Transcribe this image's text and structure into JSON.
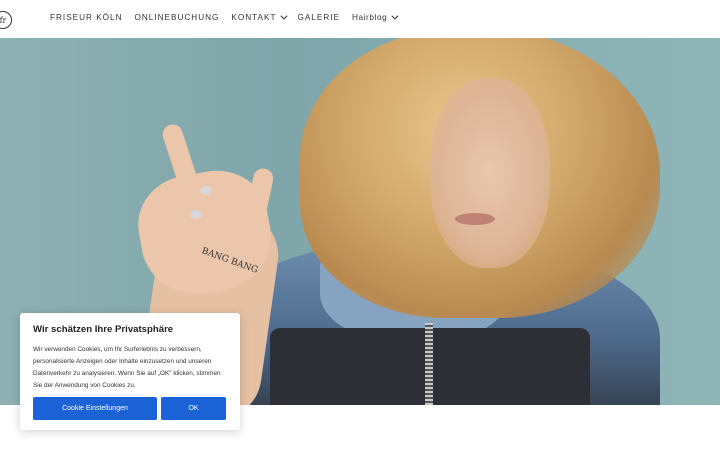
{
  "header": {
    "logo_text": "fr",
    "nav": [
      {
        "label": "FRISEUR KÖLN",
        "has_dropdown": false
      },
      {
        "label": "ONLINEBUCHUNG",
        "has_dropdown": false
      },
      {
        "label": "KONTAKT",
        "has_dropdown": true
      },
      {
        "label": "GALERIE",
        "has_dropdown": false
      },
      {
        "label": "Hairblog",
        "has_dropdown": true
      }
    ]
  },
  "hero": {
    "tattoo_text": "BANG BANG"
  },
  "cookie": {
    "title": "Wir schätzen Ihre Privatsphäre",
    "text": "Wir verwenden Cookies, um Ihr Surferlebnis zu verbessern, personalisierte Anzeigen oder Inhalte einzusetzen und unseren Datenverkehr zu analysieren. Wenn Sie auf „OK\" klicken, stimmen Sie der Anwendung von Cookies zu.",
    "settings_button": "Cookie Einstellungen",
    "ok_button": "OK",
    "button_color": "#1a62d6"
  }
}
